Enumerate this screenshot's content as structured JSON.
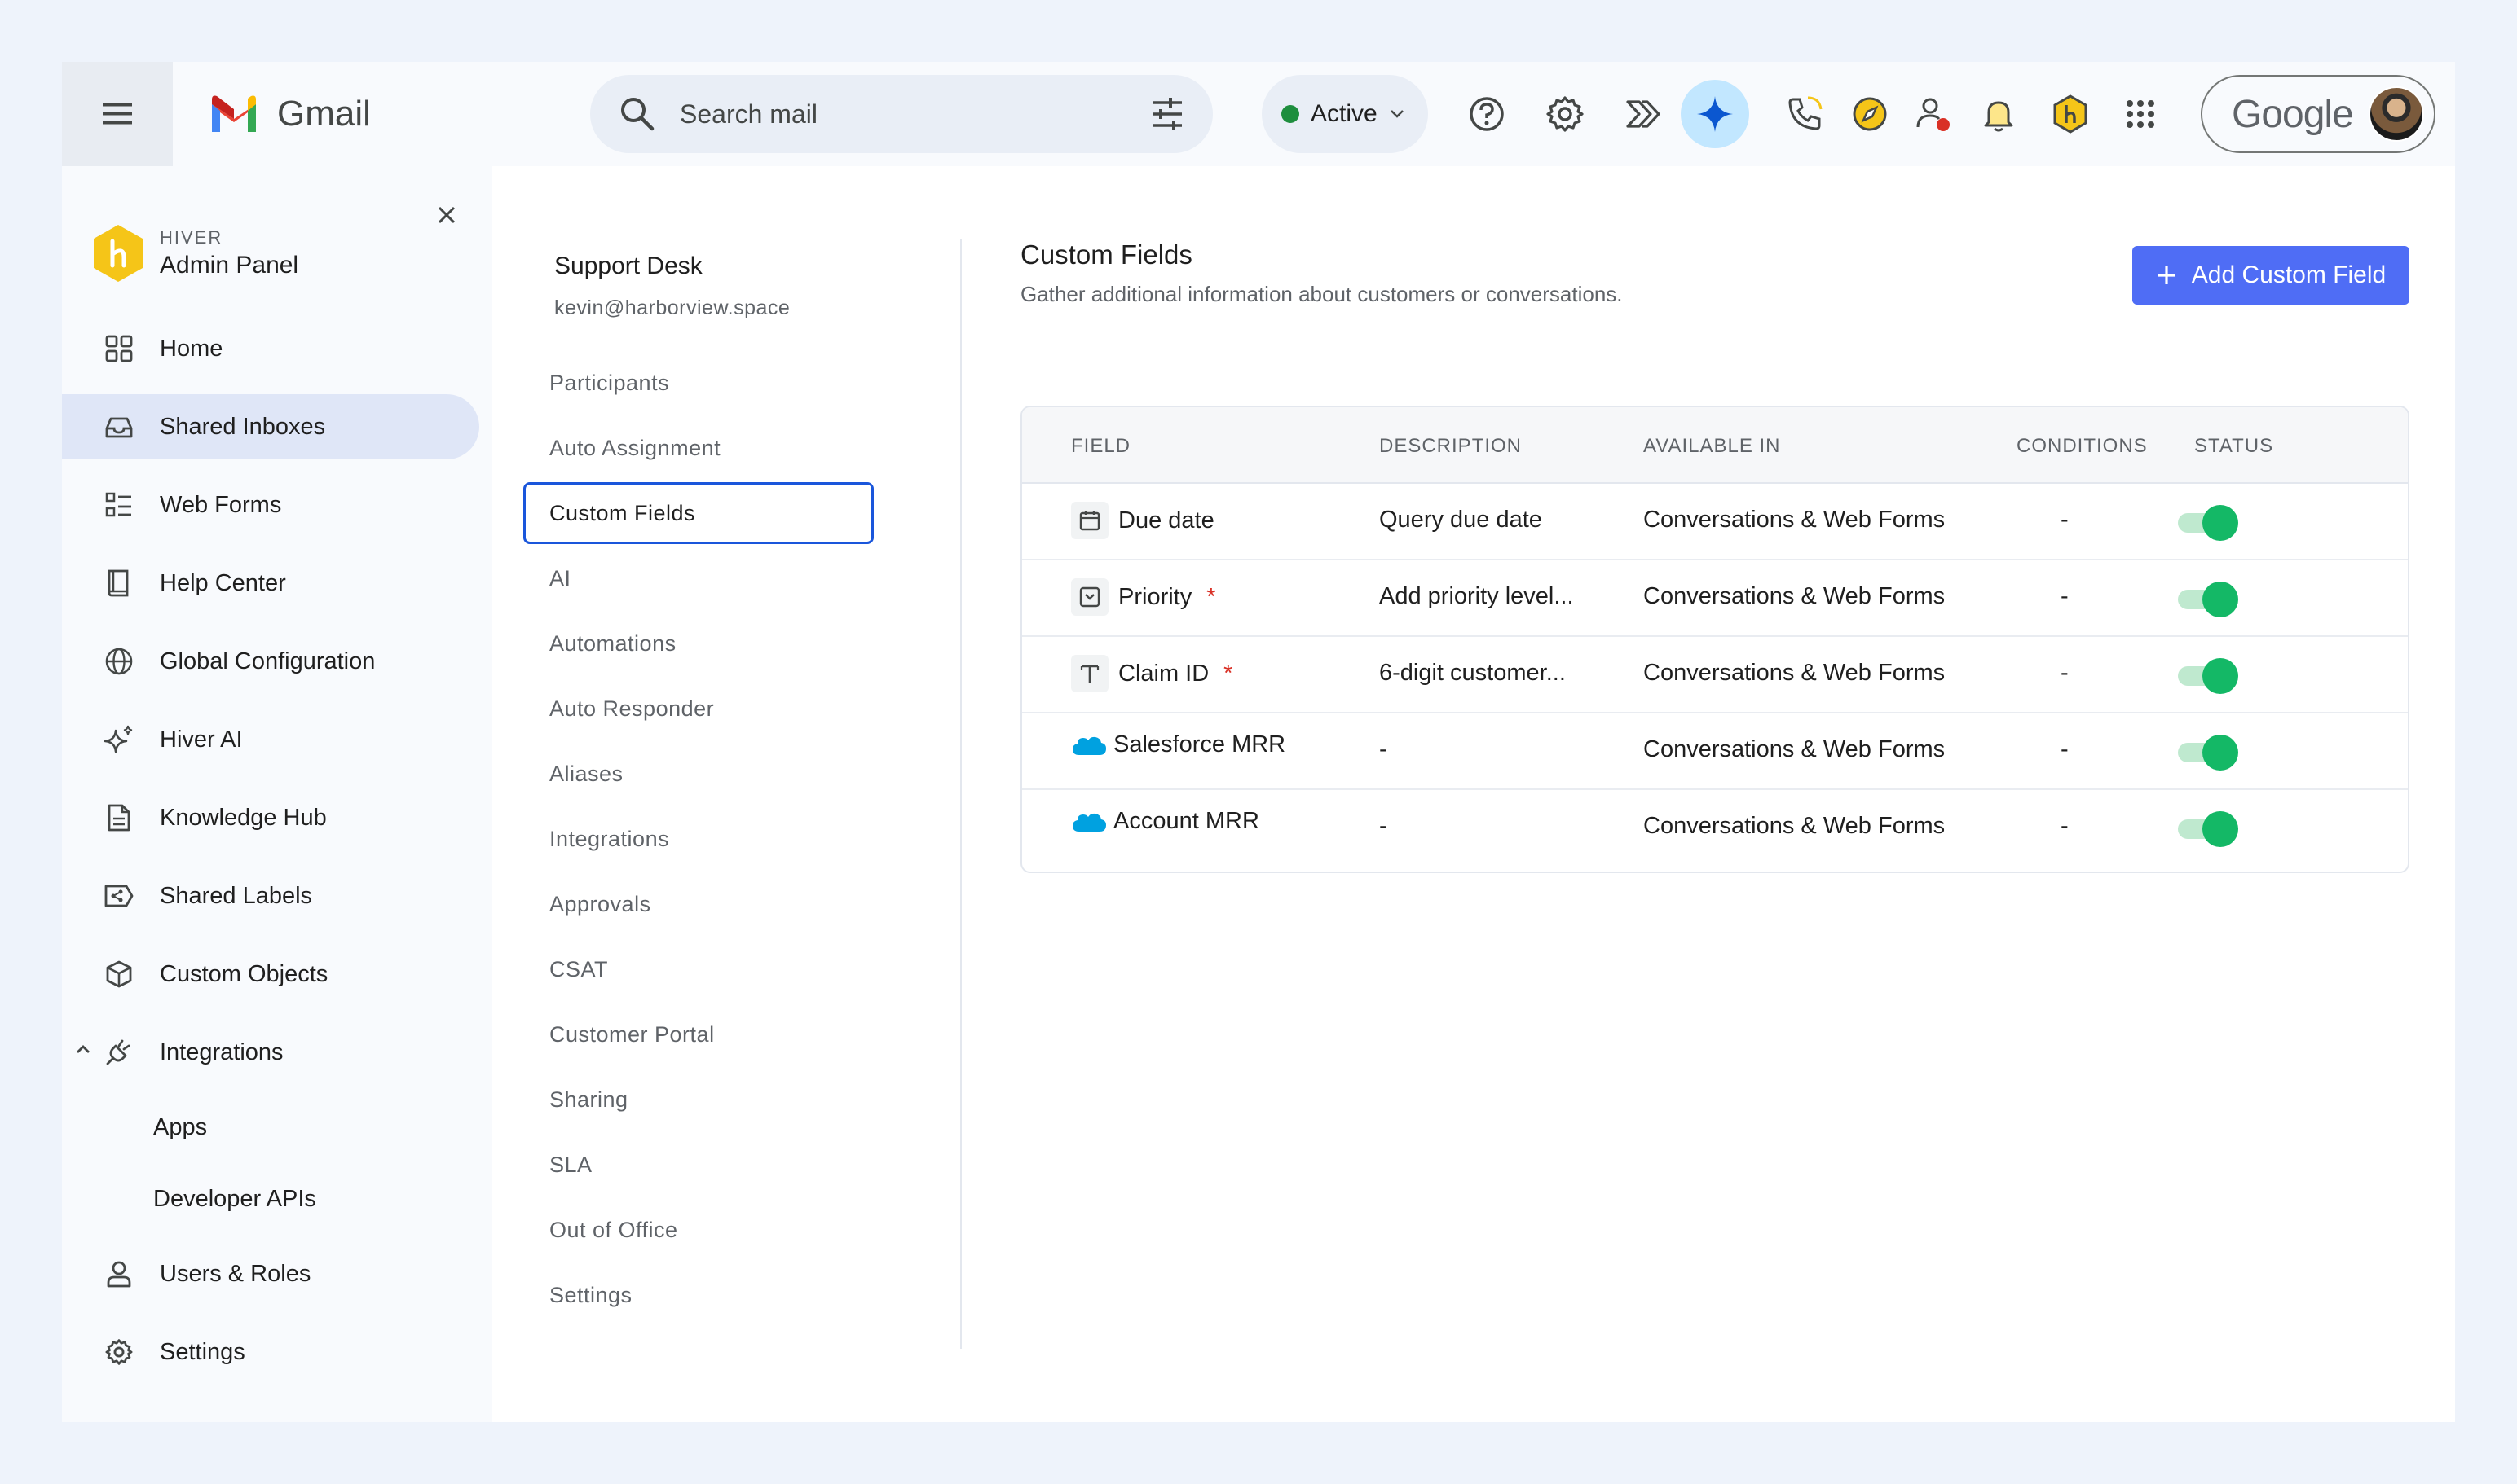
{
  "app": {
    "brand": "Gmail",
    "search_placeholder": "Search mail",
    "status": "Active",
    "google_label": "Google"
  },
  "colors": {
    "accent": "#4f6df5",
    "active_nav": "#dfe6f7",
    "toggle_on": "#14b866",
    "status_green": "#1e8e3e",
    "hiver_yellow": "#f5c518"
  },
  "icons": [
    "menu-icon",
    "gmail-logo",
    "search-icon",
    "tune-icon",
    "help-icon",
    "settings-icon",
    "hiver-forward-icon",
    "gemini-icon",
    "phone-icon",
    "compass-icon",
    "user-alert-icon",
    "bell-icon",
    "hiver-icon",
    "apps-icon"
  ],
  "admin": {
    "brand_small": "HIVER",
    "title": "Admin Panel"
  },
  "nav": [
    {
      "label": "Home",
      "icon": "grid-icon"
    },
    {
      "label": "Shared Inboxes",
      "icon": "inbox-icon",
      "active": true
    },
    {
      "label": "Web Forms",
      "icon": "list-icon"
    },
    {
      "label": "Help Center",
      "icon": "book-icon"
    },
    {
      "label": "Global Configuration",
      "icon": "globe-icon"
    },
    {
      "label": "Hiver AI",
      "icon": "sparkle-icon"
    },
    {
      "label": "Knowledge Hub",
      "icon": "document-icon"
    },
    {
      "label": "Shared Labels",
      "icon": "label-icon"
    },
    {
      "label": "Custom Objects",
      "icon": "cube-icon"
    },
    {
      "label": "Integrations",
      "icon": "plug-icon",
      "expanded": true
    },
    {
      "label": "Apps",
      "sub": true
    },
    {
      "label": "Developer APIs",
      "sub": true
    },
    {
      "label": "Users & Roles",
      "icon": "user-icon"
    },
    {
      "label": "Settings",
      "icon": "gear-icon"
    }
  ],
  "inbox": {
    "name": "Support Desk",
    "email": "kevin@harborview.space",
    "sections": [
      "Participants",
      "Auto Assignment",
      "Custom Fields",
      "AI",
      "Automations",
      "Auto Responder",
      "Aliases",
      "Integrations",
      "Approvals",
      "CSAT",
      "Customer Portal",
      "Sharing",
      "SLA",
      "Out of Office",
      "Settings"
    ],
    "active_section": "Custom Fields"
  },
  "custom_fields": {
    "title": "Custom Fields",
    "subtitle": "Gather additional information about customers or conversations.",
    "add_button": "Add Custom Field",
    "columns": [
      "FIELD",
      "DESCRIPTION",
      "AVAILABLE IN",
      "CONDITIONS",
      "STATUS"
    ],
    "rows": [
      {
        "field": "Due date",
        "icon": "calendar-icon",
        "required": false,
        "description": "Query due date",
        "available_in": "Conversations & Web Forms",
        "conditions": "-",
        "status_on": true
      },
      {
        "field": "Priority",
        "icon": "dropdown-icon",
        "required": true,
        "description": "Add priority level...",
        "available_in": "Conversations & Web Forms",
        "conditions": "-",
        "status_on": true
      },
      {
        "field": "Claim ID",
        "icon": "text-icon",
        "required": true,
        "description": "6-digit customer...",
        "available_in": "Conversations & Web Forms",
        "conditions": "-",
        "status_on": true
      },
      {
        "field": "Salesforce MRR",
        "icon": "salesforce-icon",
        "required": false,
        "description": "-",
        "available_in": "Conversations & Web Forms",
        "conditions": "-",
        "status_on": true
      },
      {
        "field": "Account MRR",
        "icon": "salesforce-icon",
        "required": false,
        "description": "-",
        "available_in": "Conversations & Web Forms",
        "conditions": "-",
        "status_on": true
      }
    ],
    "required_mark": "*"
  }
}
